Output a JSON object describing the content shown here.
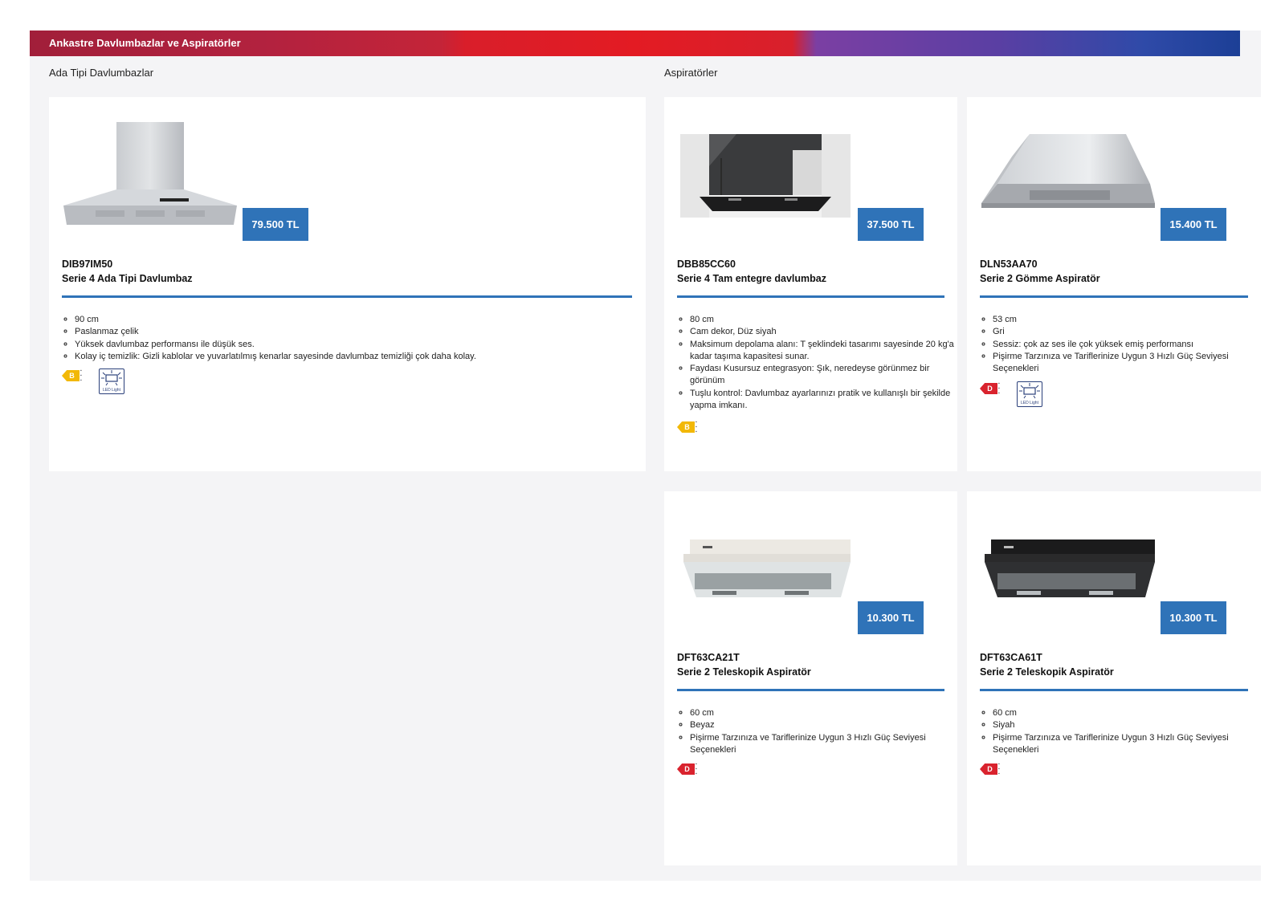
{
  "banner": {
    "title": "Ankastre Davlumbazlar ve Aspiratörler"
  },
  "sections": {
    "left": "Ada Tipi Davlumbazlar",
    "right": "Aspiratörler"
  },
  "products": [
    {
      "model": "DIB97IM50",
      "name": "Serie 4 Ada Tipi Davlumbaz",
      "price": "79.500 TL",
      "features": [
        "90 cm",
        "Paslanmaz çelik",
        "Yüksek davlumbaz performansı ile düşük ses.",
        "Kolay iç temizlik: Gizli kablolar ve yuvarlatılmış kenarlar sayesinde davlumbaz temizliği çok daha kolay."
      ],
      "energy_class": "B",
      "energy_color": "#f2b807",
      "led_label": "LED Light"
    },
    {
      "model": "DBB85CC60",
      "name": "Serie 4 Tam entegre davlumbaz",
      "price": "37.500 TL",
      "features": [
        "80 cm",
        "Cam dekor, Düz siyah",
        "Maksimum depolama alanı: T şeklindeki tasarımı sayesinde 20 kg'a kadar taşıma kapasitesi sunar.",
        "Faydası Kusursuz entegrasyon: Şık, neredeyse görünmez bir görünüm",
        "Tuşlu kontrol: Davlumbaz ayarlarınızı pratik ve kullanışlı bir şekilde yapma imkanı."
      ],
      "energy_class": "B",
      "energy_color": "#f2b807"
    },
    {
      "model": "DLN53AA70",
      "name": "Serie 2 Gömme Aspiratör",
      "price": "15.400 TL",
      "features": [
        "53 cm",
        "Gri",
        "Sessiz: çok az ses ile çok yüksek emiş performansı",
        "Pişirme Tarzınıza ve Tariflerinize Uygun 3 Hızlı Güç Seviyesi Seçenekleri"
      ],
      "energy_class": "D",
      "energy_color": "#d9232e",
      "led_label": "LED Light"
    },
    {
      "model": "DFT63CA21T",
      "name": "Serie 2 Teleskopik Aspiratör",
      "price": "10.300 TL",
      "features": [
        "60 cm",
        "Beyaz",
        "Pişirme Tarzınıza ve Tariflerinize Uygun 3 Hızlı Güç Seviyesi Seçenekleri"
      ],
      "energy_class": "D",
      "energy_color": "#d9232e"
    },
    {
      "model": "DFT63CA61T",
      "name": "Serie 2 Teleskopik Aspiratör",
      "price": "10.300 TL",
      "features": [
        "60 cm",
        "Siyah",
        "Pişirme Tarzınıza ve Tariflerinize Uygun 3 Hızlı Güç Seviyesi Seçenekleri"
      ],
      "energy_class": "D",
      "energy_color": "#d9232e"
    }
  ]
}
